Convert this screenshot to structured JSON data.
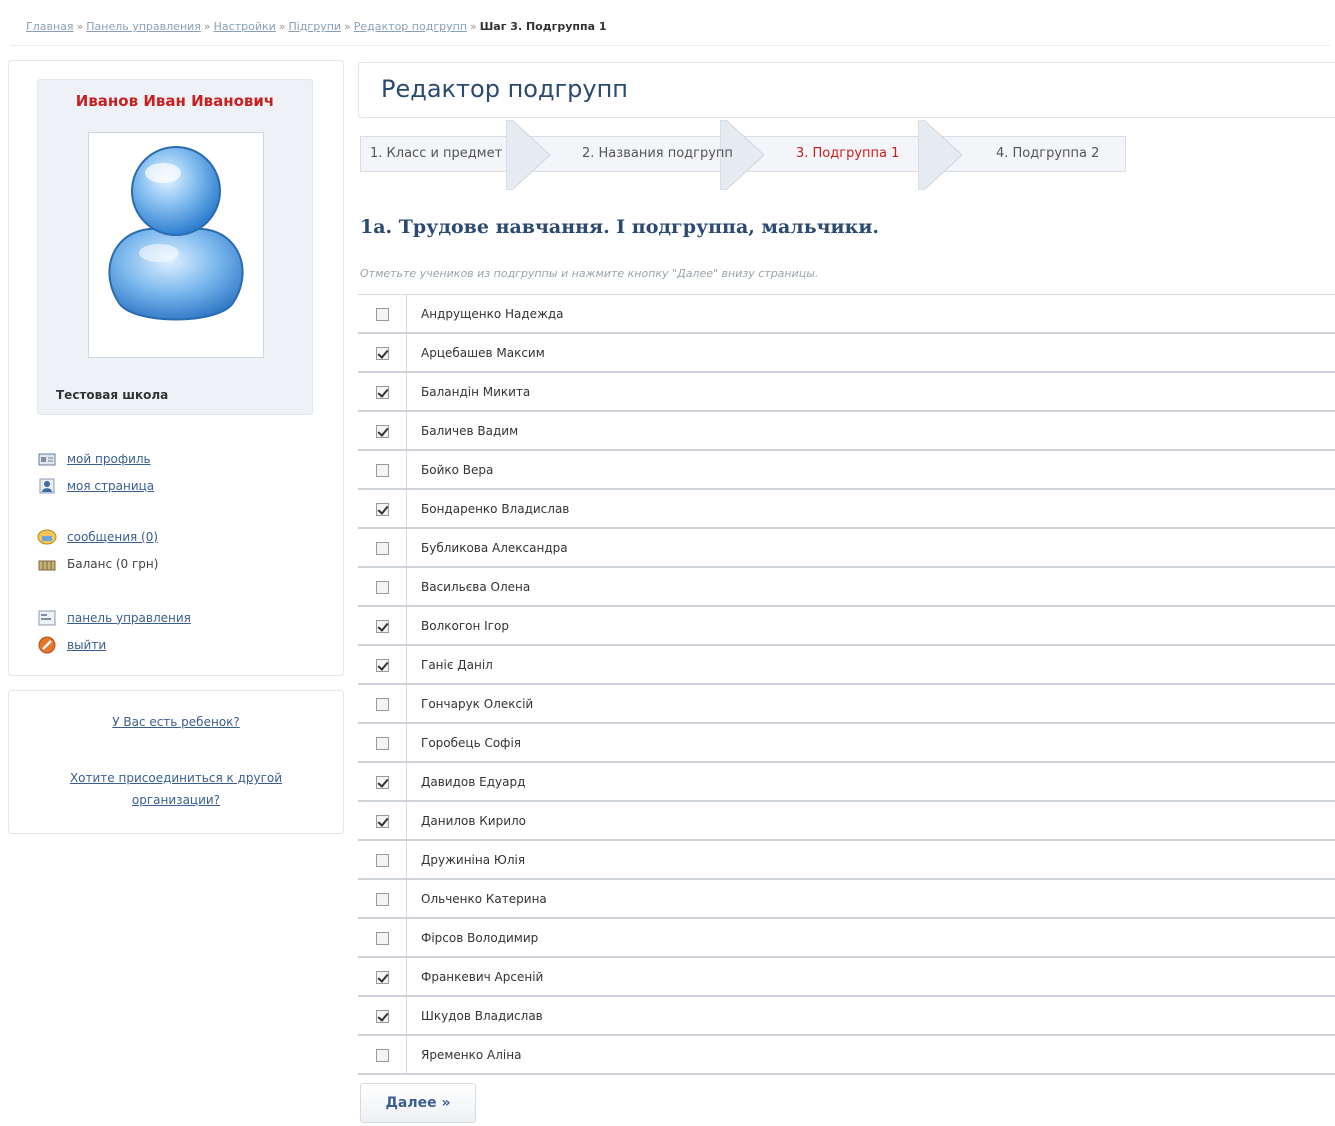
{
  "breadcrumb": {
    "items": [
      "Главная",
      "Панель управления",
      "Настройки",
      "Підгрупи",
      "Редактор подгрупп"
    ],
    "current": "Шаг 3. Подгруппа 1",
    "separator": "»"
  },
  "profile": {
    "name": "Иванов Иван Иванович",
    "school": "Тестовая школа"
  },
  "menu": {
    "my_profile": "мой профиль",
    "my_page": "моя страница",
    "messages": "сообщения (0)",
    "balance": "Баланс (0 грн)",
    "control_panel": "панель управления",
    "logout": "выйти"
  },
  "side_links": {
    "have_child": "У Вас есть ребенок?",
    "join_org_line1": "Хотите присоединиться к другой",
    "join_org_line2": "организации?"
  },
  "page": {
    "title": "Редактор подгрупп",
    "steps": [
      "1. Класс и предмет",
      "2. Названия подгрупп",
      "3. Подгруппа 1",
      "4. Подгруппа 2"
    ],
    "active_step": 2,
    "section_title": "1а. Трудове навчання. I подгруппа, мальчики.",
    "hint": "Отметьте учеников из подгруппы и нажмите кнопку \"Далее\" внизу страницы.",
    "next_button": "Далее »"
  },
  "students": [
    {
      "name": "Андрущенко  Надежда",
      "checked": false
    },
    {
      "name": "Арцебашев Максим",
      "checked": true
    },
    {
      "name": "Баландін Микита",
      "checked": true
    },
    {
      "name": "Баличев Вадим",
      "checked": true
    },
    {
      "name": "Бойко Вера",
      "checked": false
    },
    {
      "name": "Бондаренко Владислав",
      "checked": true
    },
    {
      "name": "Бубликова Александра",
      "checked": false
    },
    {
      "name": "Васильєва Олена",
      "checked": false
    },
    {
      "name": "Волкогон Ігор",
      "checked": true
    },
    {
      "name": "Ганіє Данiл",
      "checked": true
    },
    {
      "name": "Гончарук Олексій",
      "checked": false
    },
    {
      "name": "Горобець Софія",
      "checked": false
    },
    {
      "name": "Давидов Едуард",
      "checked": true
    },
    {
      "name": "Данилов Кирило",
      "checked": true
    },
    {
      "name": "Дружиніна Юлія",
      "checked": false
    },
    {
      "name": "Ольченко Катерина",
      "checked": false
    },
    {
      "name": "Фірсов Володимир",
      "checked": false
    },
    {
      "name": "Франкевич Арсеній",
      "checked": true
    },
    {
      "name": "Шкудов Владислав",
      "checked": true
    },
    {
      "name": "Яременко Аліна",
      "checked": false
    }
  ]
}
